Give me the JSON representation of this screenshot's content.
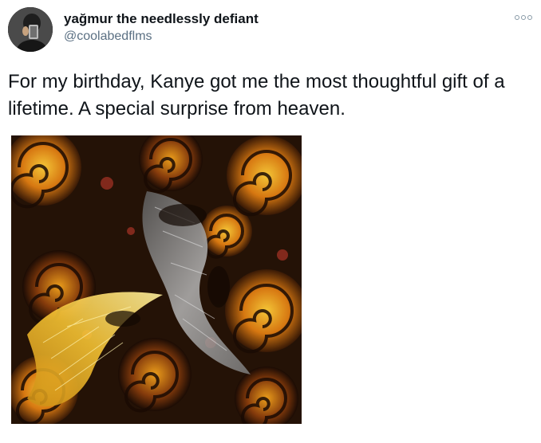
{
  "tweet": {
    "author": {
      "display_name": "yağmur the needlessly defiant",
      "handle": "@coolabedflms"
    },
    "text": "For my birthday, Kanye got me the most thoughtful gift of a lifetime. A special surprise from heaven.",
    "media": {
      "kind": "fractal-artwork",
      "palette": [
        "#1a0d05",
        "#d97a12",
        "#f2b01e",
        "#8c8c8c",
        "#c0392b"
      ]
    },
    "more_icon": "more-options-icon"
  }
}
